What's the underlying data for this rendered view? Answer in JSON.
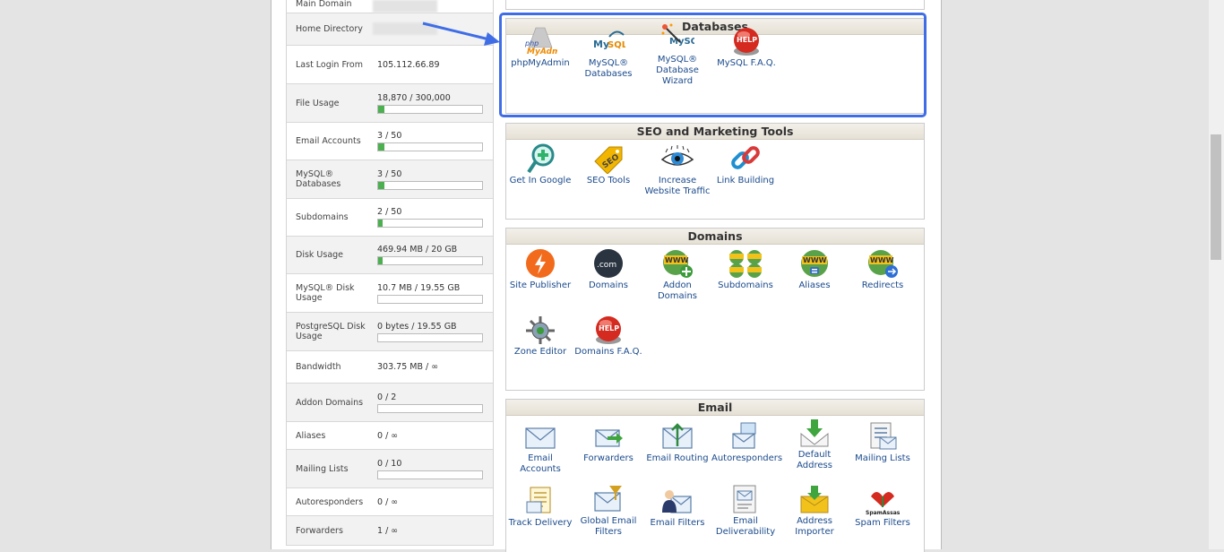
{
  "stats": [
    {
      "label": "Main Domain",
      "value": "",
      "bar": null,
      "blur": true
    },
    {
      "label": "Home Directory",
      "value": "",
      "bar": null,
      "blur": true
    },
    {
      "label": "Last Login From",
      "value": "105.112.66.89",
      "bar": null
    },
    {
      "label": "File Usage",
      "value": "18,870 / 300,000",
      "bar": 0.063
    },
    {
      "label": "Email Accounts",
      "value": "3 / 50",
      "bar": 0.06
    },
    {
      "label": "MySQL® Databases",
      "value": "3 / 50",
      "bar": 0.06
    },
    {
      "label": "Subdomains",
      "value": "2 / 50",
      "bar": 0.04
    },
    {
      "label": "Disk Usage",
      "value": "469.94 MB / 20 GB",
      "bar": 0.023
    },
    {
      "label": "MySQL® Disk Usage",
      "value": "10.7 MB / 19.55 GB",
      "bar": 0.0
    },
    {
      "label": "PostgreSQL Disk Usage",
      "value": "0 bytes / 19.55 GB",
      "bar": 0.0
    },
    {
      "label": "Bandwidth",
      "value": "303.75 MB / ∞",
      "bar": null
    },
    {
      "label": "Addon Domains",
      "value": "0 / 2",
      "bar": 0.0
    },
    {
      "label": "Aliases",
      "value": "0 / ∞",
      "bar": null
    },
    {
      "label": "Mailing Lists",
      "value": "0 / 10",
      "bar": 0.0
    },
    {
      "label": "Autoresponders",
      "value": "0 / ∞",
      "bar": null
    },
    {
      "label": "Forwarders",
      "value": "1 / ∞",
      "bar": null
    }
  ],
  "panels": {
    "databases": {
      "title": "Databases",
      "items": [
        {
          "label": "phpMyAdmin",
          "icon": "phpmyadmin-icon"
        },
        {
          "label": "MySQL® Databases",
          "icon": "mysql-icon"
        },
        {
          "label": "MySQL® Database Wizard",
          "icon": "mysql-wizard-icon"
        },
        {
          "label": "MySQL F.A.Q.",
          "icon": "help-icon"
        }
      ]
    },
    "seo": {
      "title": "SEO and Marketing Tools",
      "items": [
        {
          "label": "Get In Google",
          "icon": "magnifier-plus-icon"
        },
        {
          "label": "SEO Tools",
          "icon": "seo-tag-icon"
        },
        {
          "label": "Increase Website Traffic",
          "icon": "eye-icon"
        },
        {
          "label": "Link Building",
          "icon": "chain-link-icon"
        }
      ]
    },
    "domains": {
      "title": "Domains",
      "items": [
        {
          "label": "Site Publisher",
          "icon": "lightning-icon"
        },
        {
          "label": "Domains",
          "icon": "dotcom-icon"
        },
        {
          "label": "Addon Domains",
          "icon": "www-plus-icon"
        },
        {
          "label": "Subdomains",
          "icon": "www-multi-icon"
        },
        {
          "label": "Aliases",
          "icon": "www-alias-icon"
        },
        {
          "label": "Redirects",
          "icon": "www-redirect-icon"
        },
        {
          "label": "Zone Editor",
          "icon": "zone-editor-icon"
        },
        {
          "label": "Domains F.A.Q.",
          "icon": "help-icon"
        }
      ]
    },
    "email": {
      "title": "Email",
      "items": [
        {
          "label": "Email Accounts",
          "icon": "envelope-icon"
        },
        {
          "label": "Forwarders",
          "icon": "envelope-arrow-icon"
        },
        {
          "label": "Email Routing",
          "icon": "envelope-route-icon"
        },
        {
          "label": "Autoresponders",
          "icon": "envelope-reply-icon"
        },
        {
          "label": "Default Address",
          "icon": "envelope-download-icon"
        },
        {
          "label": "Mailing Lists",
          "icon": "mailing-list-icon"
        },
        {
          "label": "Track Delivery",
          "icon": "track-delivery-icon"
        },
        {
          "label": "Global Email Filters",
          "icon": "global-filter-icon"
        },
        {
          "label": "Email Filters",
          "icon": "email-filter-icon"
        },
        {
          "label": "Email Deliverability",
          "icon": "deliverability-icon"
        },
        {
          "label": "Address Importer",
          "icon": "address-importer-icon"
        },
        {
          "label": "Spam Filters",
          "icon": "spamassassin-icon"
        }
      ]
    }
  },
  "colors": {
    "link": "#1a4a8c",
    "highlight": "#3f6de6",
    "bar": "#4caf50"
  }
}
